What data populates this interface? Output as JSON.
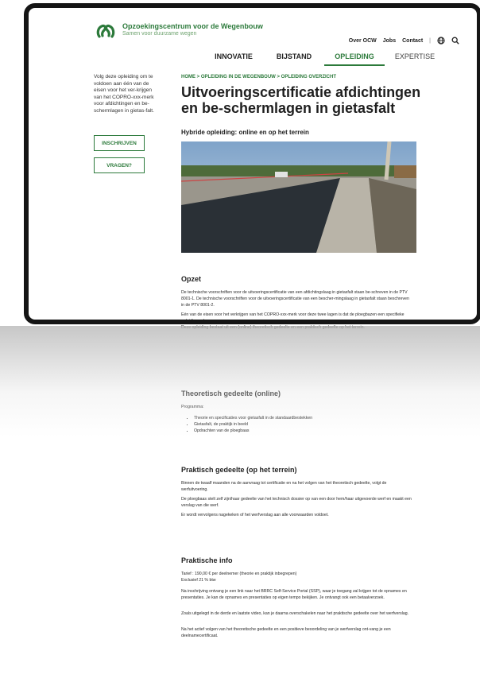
{
  "brand": {
    "name": "Opzoekingscentrum voor de Wegenbouw",
    "tagline": "Samen voor duurzame wegen"
  },
  "util_nav": {
    "items": [
      "Over OCW",
      "Jobs",
      "Contact"
    ],
    "separator": "|"
  },
  "main_nav": {
    "items": [
      "INNOVATIE",
      "BIJSTAND",
      "OPLEIDING",
      "EXPERTISE"
    ],
    "active": "OPLEIDING"
  },
  "sidebar": {
    "text": "Volg deze opleiding om te voldoen aan één van de eisen voor het ver-krijgen van het COPRO-xxx-merk voor afdichtingen en be-schermlagen in gietas-falt.",
    "register_label": "INSCHRIJVEN",
    "questions_label": "VRAGEN?"
  },
  "breadcrumb": "HOME  >  OPLEIDING IN DE WEGENBOUW  >  OPLEIDING OVERZICHT",
  "title": "Uitvoeringscertificatie afdichtingen en be-schermlagen in gietasfalt",
  "subtitle": "Hybride opleiding: online en op het terrein",
  "sections": {
    "opzet": {
      "heading": "Opzet",
      "p1": "De technische voorschriften voor de uitvoeringscertificatie van een afdichtingslaag in gietasfalt staan be-schreven in de PTV 8001-1. De technische voorschriften voor de uitvoeringscertificatie van een bescher-mingslaag in gietasfalt staan beschreven in de PTV 8001-2.",
      "p2": "Eén van de eisen voor het verkrijgen van het COPRO-xxx-merk voor deze twee lagen is dat de ploegbazen een specifieke opleiding volgen.",
      "p3": "Deze opleiding bestaat uit een (online) theoretisch gedeelte en een praktisch gedeelte op het terrein."
    },
    "theorie": {
      "heading": "Theoretisch gedeelte (online)",
      "intro": "Programma:",
      "items": [
        "Theorie en specificaties voor gietasfalt in de standaardbestekken",
        "Gietasfalt, de praktijk in beeld",
        "Opdrachten van de ploegbaas"
      ]
    },
    "praktijk": {
      "heading": "Praktisch gedeelte (op het terrein)",
      "p1": "Binnen de twaalf maanden na de aanvraag tot certificatie en na het volgen van het theoretisch gedeelte, volgt de werfuitvoering.",
      "p2": "De ploegbaas stelt zelf zijn/haar gedeelte van het technisch dossier op van een door hem/haar uitgevoerde werf en maakt een verslag van die werf.",
      "p3": "Er wordt vervolgens nagekeken of het werfverslag aan alle voorwaarden voldoet."
    },
    "info": {
      "heading": "Praktische info",
      "price": "Tarief : 190,00 € per deelnemer (theorie en praktijk inbegrepen)",
      "vat": "Exclusief 21 % btw",
      "p1": "Na inschrijving ontvang je een link naar het BRRC Self-Service Portal (SSP), waar je toegang zal krijgen tot de opnames en presentaties. Je kan de opnames en presentaties op eigen tempo bekijken. Je ontvangt ook een betaalverzoek.",
      "p2": "Zoals uitgelegd in de derde en laatste video, kan je daarna overschakelen naar het praktische gedeelte over het werfverslag.",
      "p3": "Na het actief volgen van het theoretische gedeelte en een positieve beoordeling van je werfverslag ont-vang je een deelnamecertificaat."
    }
  },
  "colors": {
    "brand_green": "#2c7a3b",
    "frame": "#151515"
  }
}
